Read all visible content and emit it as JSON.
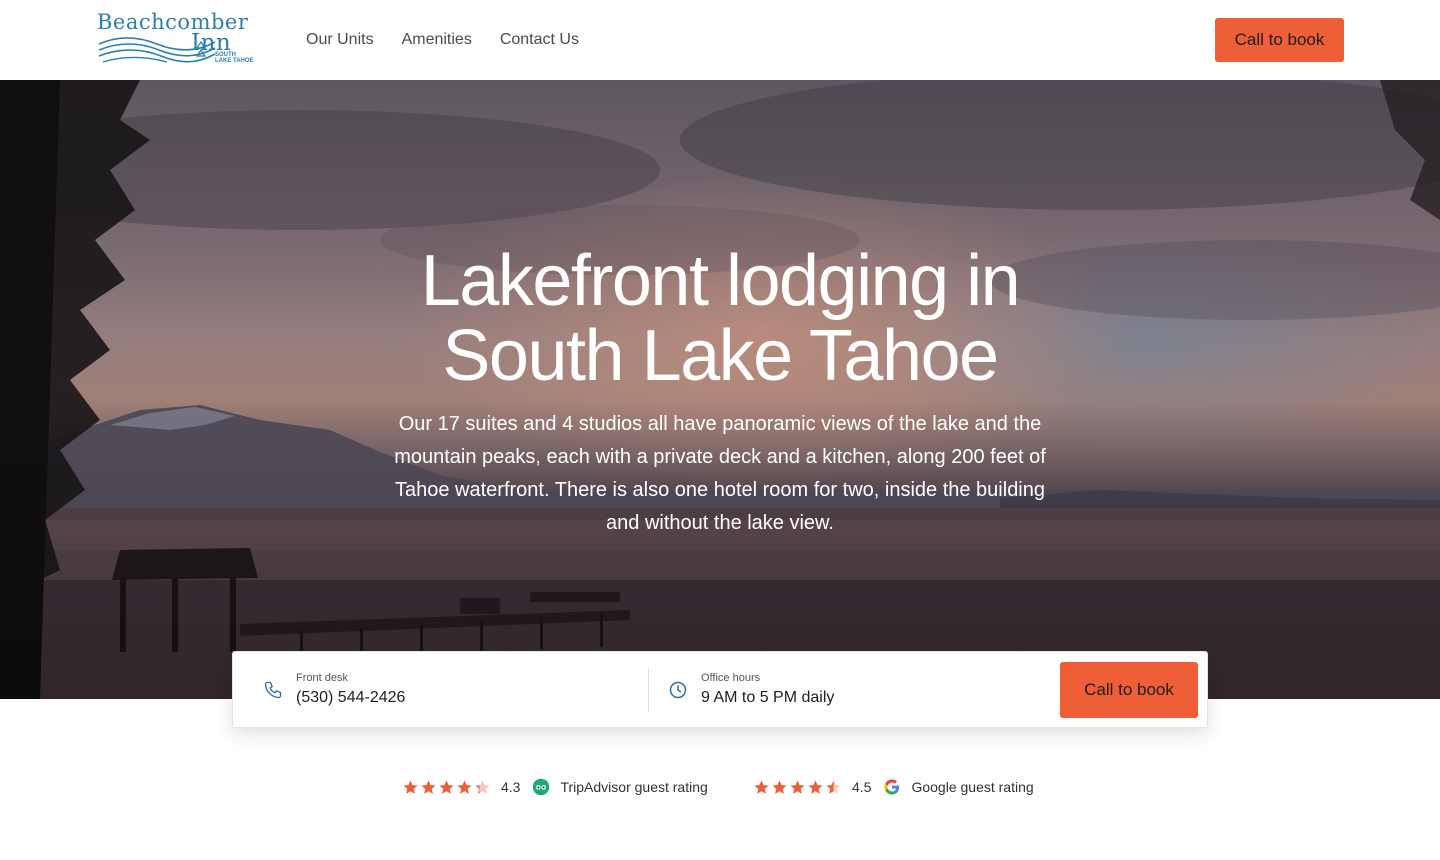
{
  "header": {
    "logo": {
      "line1": "Beachcomber",
      "line2": "Inn",
      "sub1": "SOUTH",
      "sub2": "LAKE TAHOE"
    },
    "nav": [
      {
        "label": "Our Units"
      },
      {
        "label": "Amenities"
      },
      {
        "label": "Contact Us"
      }
    ],
    "cta_label": "Call to book"
  },
  "hero": {
    "title_line1": "Lakefront lodging in",
    "title_line2": "South Lake Tahoe",
    "description": "Our 17 suites and 4 studios all have panoramic views of the lake and the mountain peaks, each with a private deck and a kitchen, along 200 feet of Tahoe waterfront. There is also one hotel room for two, inside the building and without the lake view."
  },
  "info_card": {
    "front_desk": {
      "label": "Front desk",
      "value": "(530) 544-2426",
      "icon": "phone-icon"
    },
    "office_hours": {
      "label": "Office hours",
      "value": "9 AM to 5 PM daily",
      "icon": "clock-icon"
    },
    "cta_label": "Call to book"
  },
  "ratings": [
    {
      "score": "4.3",
      "stars": 4.3,
      "source_icon": "tripadvisor-icon",
      "label": "TripAdvisor guest rating"
    },
    {
      "score": "4.5",
      "stars": 4.5,
      "source_icon": "google-icon",
      "label": "Google guest rating"
    }
  ],
  "colors": {
    "accent": "#ee5e37",
    "logo_blue": "#2a7fb0",
    "icon_blue": "#2f6f9e",
    "star_empty": "#f6c9bb"
  }
}
